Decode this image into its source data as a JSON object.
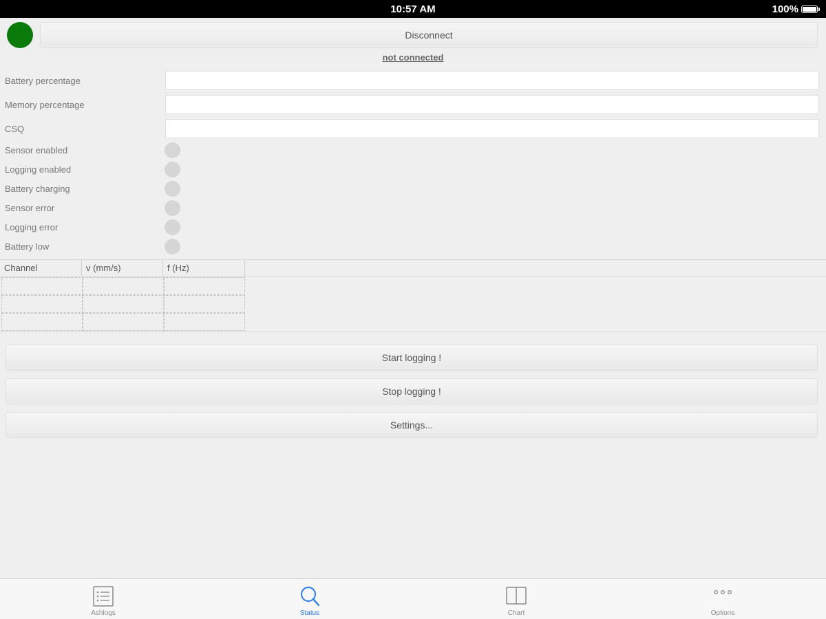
{
  "status_bar": {
    "time": "10:57 AM",
    "battery": "100%"
  },
  "connection": {
    "indicator_color": "#0a7a0a",
    "disconnect_label": "Disconnect",
    "status_text": "not connected"
  },
  "fields": [
    {
      "label": "Battery percentage",
      "value": ""
    },
    {
      "label": "Memory percentage",
      "value": ""
    },
    {
      "label": "CSQ",
      "value": ""
    }
  ],
  "indicators": [
    {
      "label": "Sensor enabled"
    },
    {
      "label": "Logging enabled"
    },
    {
      "label": "Battery charging"
    },
    {
      "label": "Sensor error"
    },
    {
      "label": "Logging error"
    },
    {
      "label": "Battery low"
    }
  ],
  "table": {
    "columns": [
      "Channel",
      "v (mm/s)",
      "f (Hz)"
    ],
    "rows": [
      [
        "",
        "",
        ""
      ],
      [
        "",
        "",
        ""
      ],
      [
        "",
        "",
        ""
      ]
    ]
  },
  "actions": {
    "start_logging": "Start logging !",
    "stop_logging": "Stop logging !",
    "settings": "Settings..."
  },
  "tabs": [
    {
      "label": "Ashlogs",
      "icon": "list-icon"
    },
    {
      "label": "Status",
      "icon": "search-icon",
      "active": true
    },
    {
      "label": "Chart",
      "icon": "book-icon"
    },
    {
      "label": "Options",
      "icon": "more-icon"
    }
  ],
  "colors": {
    "accent": "#2b7de9",
    "connected_green": "#0a7a0a",
    "indicator_off": "#d6d6d6"
  }
}
